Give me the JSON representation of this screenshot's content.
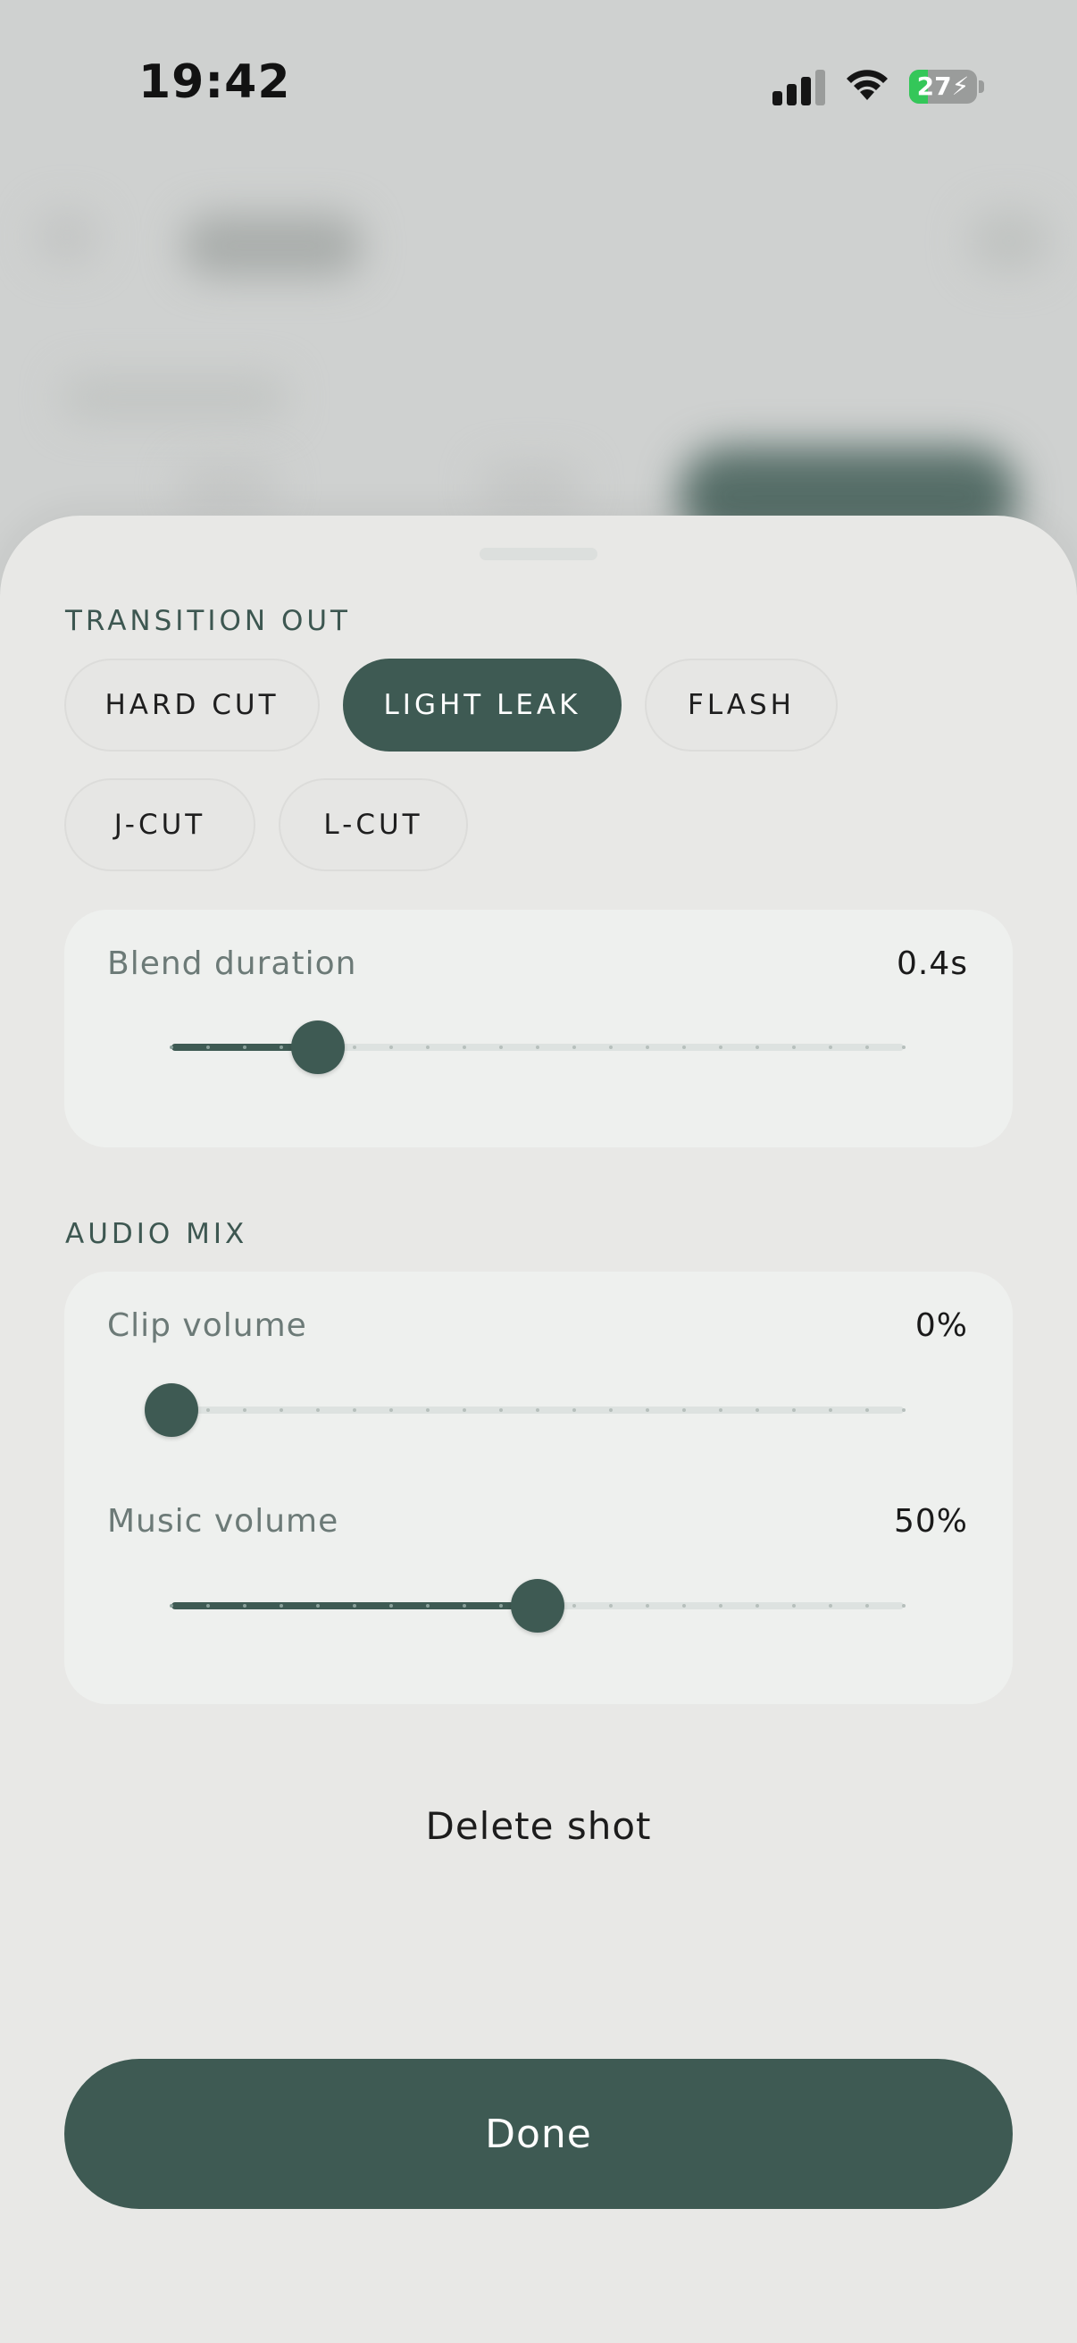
{
  "status_bar": {
    "time": "19:42",
    "battery_percent": "27",
    "battery_level": 0.27,
    "signal_bars": 4,
    "signal_bars_active": 3,
    "wifi": "wifi-icon",
    "charging_icon": "bolt-icon"
  },
  "colors": {
    "accent": "#3e5a53",
    "sheet_bg": "#e8e8e6",
    "card_bg": "#eef0ee",
    "battery_green": "#34c759"
  },
  "transition": {
    "section_label": "TRANSITION OUT",
    "options": [
      {
        "label": "HARD CUT",
        "selected": false
      },
      {
        "label": "LIGHT LEAK",
        "selected": true
      },
      {
        "label": "FLASH",
        "selected": false
      },
      {
        "label": "J-CUT",
        "selected": false
      },
      {
        "label": "L-CUT",
        "selected": false
      }
    ],
    "blend": {
      "label": "Blend duration",
      "value_text": "0.4s",
      "fraction": 0.2,
      "tick_count": 21
    }
  },
  "audio": {
    "section_label": "AUDIO MIX",
    "clip": {
      "label": "Clip volume",
      "value_text": "0%",
      "fraction": 0.0,
      "tick_count": 21
    },
    "music": {
      "label": "Music volume",
      "value_text": "50%",
      "fraction": 0.5,
      "tick_count": 21
    }
  },
  "actions": {
    "delete_label": "Delete shot",
    "done_label": "Done"
  }
}
